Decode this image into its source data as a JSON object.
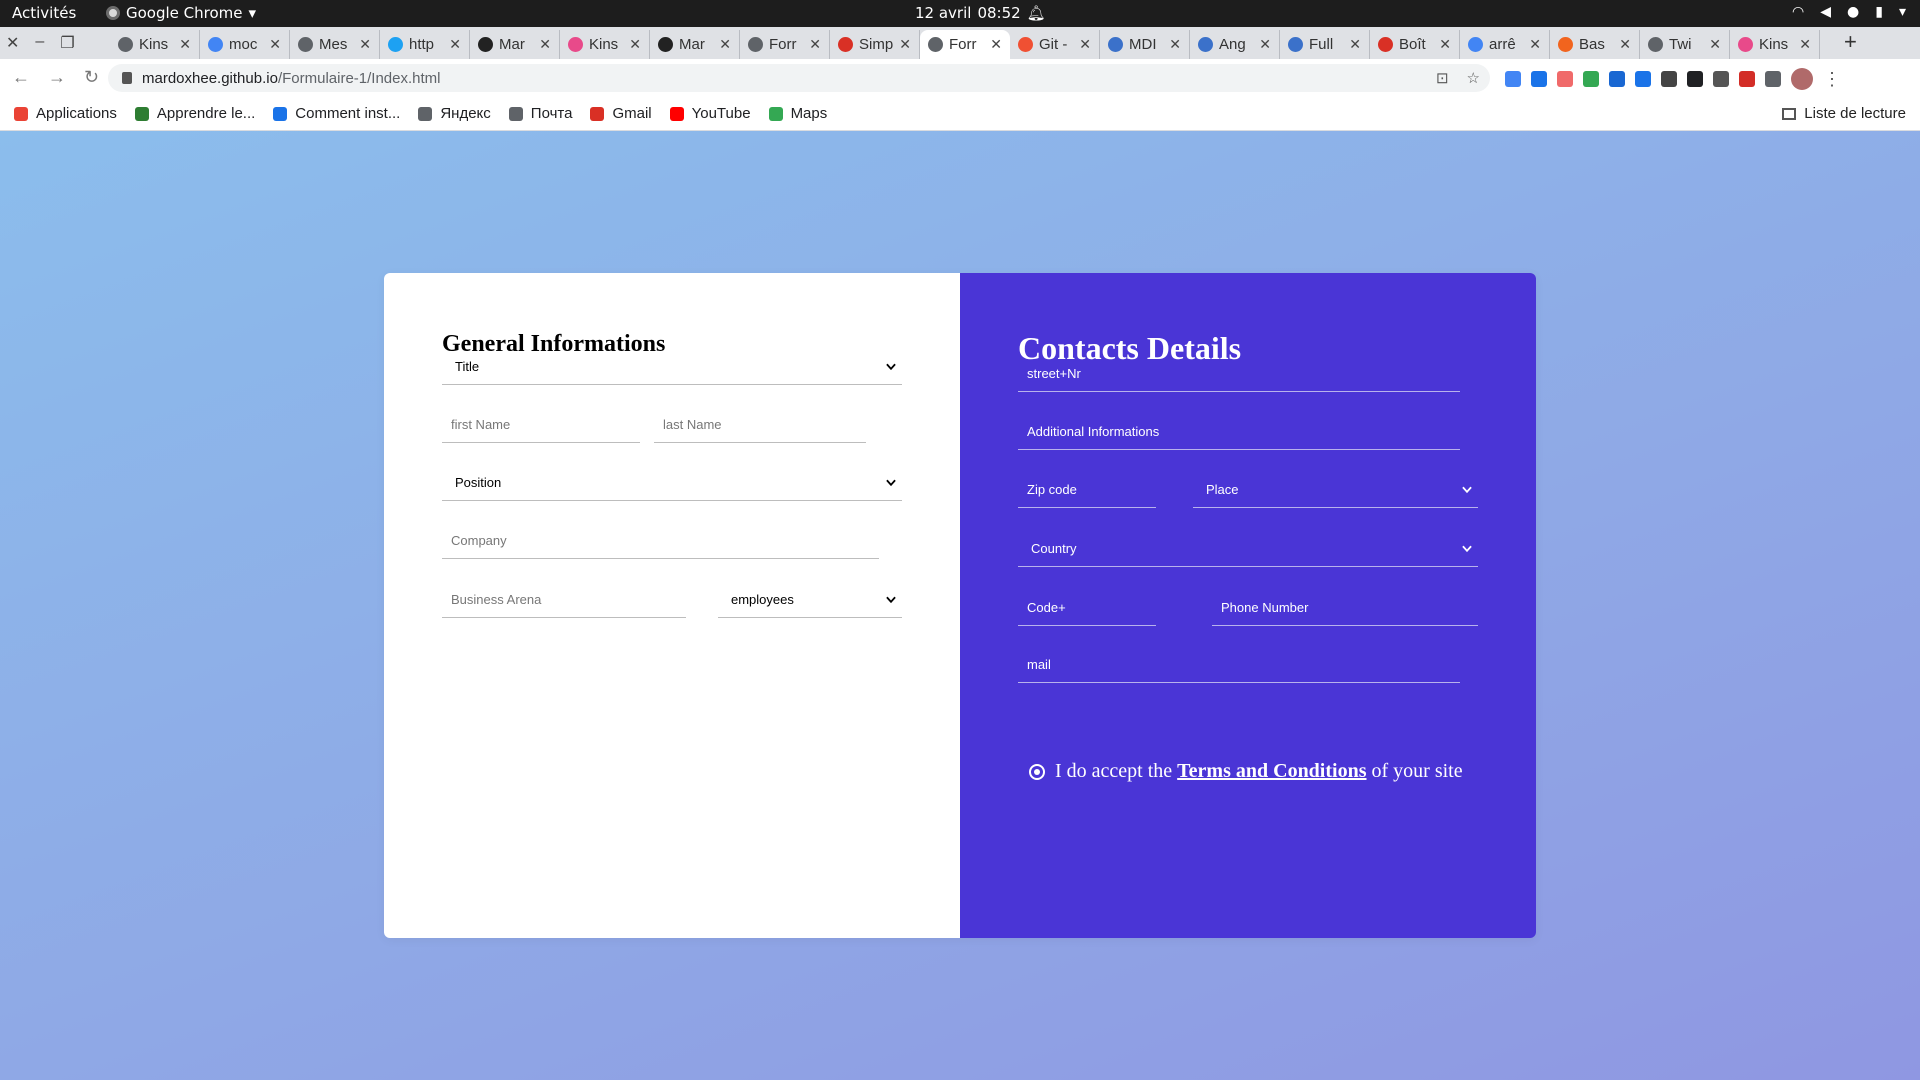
{
  "os_bar": {
    "activities": "Activités",
    "app_name": "Google Chrome",
    "date": "12 avril",
    "time": "08:52"
  },
  "tabs": [
    {
      "label": "Kins",
      "icon": "globe-icon",
      "color": "#5f6368"
    },
    {
      "label": "moc",
      "icon": "google-icon",
      "color": "#4285f4"
    },
    {
      "label": "Mes",
      "icon": "globe-icon",
      "color": "#5f6368"
    },
    {
      "label": "http",
      "icon": "twitter-icon",
      "color": "#1da1f2"
    },
    {
      "label": "Mar",
      "icon": "github-icon",
      "color": "#222222"
    },
    {
      "label": "Kins",
      "icon": "play-icon",
      "color": "#e84a8a"
    },
    {
      "label": "Mar",
      "icon": "github-icon",
      "color": "#222222"
    },
    {
      "label": "Forr",
      "icon": "globe-icon",
      "color": "#5f6368"
    },
    {
      "label": "Simp",
      "icon": "alert-icon",
      "color": "#d93025"
    },
    {
      "label": "Forr",
      "icon": "globe-icon",
      "color": "#5f6368",
      "active": true
    },
    {
      "label": "Git -",
      "icon": "git-icon",
      "color": "#f05033"
    },
    {
      "label": "MDI",
      "icon": "mdb-icon",
      "color": "#3b71ca"
    },
    {
      "label": "Ang",
      "icon": "mdb-icon",
      "color": "#3b71ca"
    },
    {
      "label": "Full",
      "icon": "mdb-icon",
      "color": "#3b71ca"
    },
    {
      "label": "Boît",
      "icon": "gmail-icon",
      "color": "#d93025"
    },
    {
      "label": "arrê",
      "icon": "google-icon",
      "color": "#4285f4"
    },
    {
      "label": "Bas",
      "icon": "etsy-icon",
      "color": "#f1641e"
    },
    {
      "label": "Twi",
      "icon": "globe-icon",
      "color": "#5f6368"
    },
    {
      "label": "Kins",
      "icon": "play-icon",
      "color": "#e84a8a"
    }
  ],
  "address_bar": {
    "url_host": "mardoxhee.github.io",
    "url_path": "/Formulaire-1/Index.html"
  },
  "bookmarks": [
    {
      "label": "Applications",
      "icon": "apps-grid-icon",
      "color": "#ea4335"
    },
    {
      "label": "Apprendre le...",
      "icon": "mountain-icon",
      "color": "#2e7d32"
    },
    {
      "label": "Comment inst...",
      "icon": "arrow-up-icon",
      "color": "#1a73e8"
    },
    {
      "label": "Яндекс",
      "icon": "globe-icon",
      "color": "#5f6368"
    },
    {
      "label": "Почта",
      "icon": "globe-icon",
      "color": "#5f6368"
    },
    {
      "label": "Gmail",
      "icon": "gmail-icon",
      "color": "#d93025"
    },
    {
      "label": "YouTube",
      "icon": "youtube-icon",
      "color": "#ff0000"
    },
    {
      "label": "Maps",
      "icon": "maps-icon",
      "color": "#34a853"
    }
  ],
  "reading_list": "Liste de lecture",
  "general": {
    "heading": "General Informations",
    "title_select": "Title",
    "first_name_placeholder": "first Name",
    "last_name_placeholder": "last Name",
    "position_select": "Position",
    "company_placeholder": "Company",
    "business_placeholder": "Business Arena",
    "employees_select": "employees"
  },
  "contacts": {
    "heading": "Contacts Details",
    "street_placeholder": "street+Nr",
    "additional_placeholder": "Additional Informations",
    "zip_placeholder": "Zip code",
    "place_select": "Place",
    "country_select": "Country",
    "code_placeholder": "Code+",
    "phone_placeholder": "Phone Number",
    "mail_placeholder": "mail",
    "terms_prefix": "I do accept the",
    "terms_link": "Terms and Conditions",
    "terms_suffix": "of your site"
  },
  "colors": {
    "page_gradient_start": "#8bbdec",
    "page_gradient_end": "#8f97e2",
    "contact_panel": "#4a35d6"
  }
}
